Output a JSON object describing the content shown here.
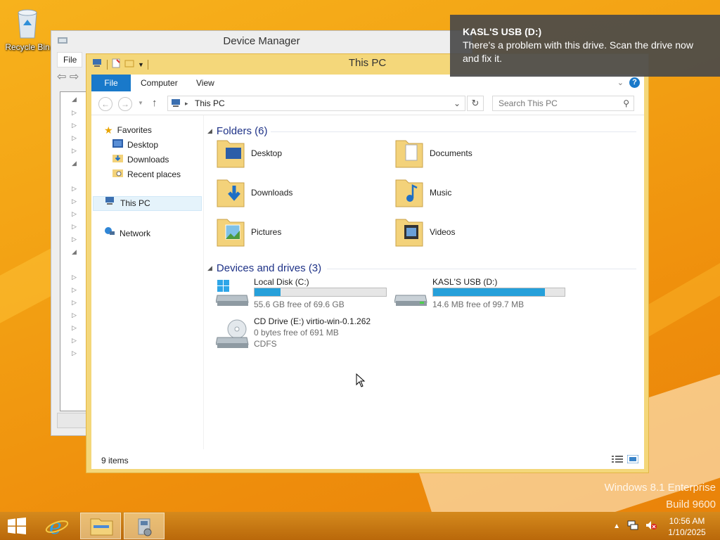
{
  "desktop": {
    "recycle_bin_label": "Recycle Bin",
    "watermark_line1": "Windows 8.1 Enterprise",
    "watermark_line2": "Build 9600"
  },
  "device_manager": {
    "title": "Device Manager",
    "menu_file": "File"
  },
  "explorer": {
    "title": "This PC",
    "ribbon_tabs": {
      "file": "File",
      "computer": "Computer",
      "view": "View"
    },
    "help_glyph": "?",
    "address": "This PC",
    "search_placeholder": "Search This PC",
    "nav": {
      "favorites": "Favorites",
      "desktop": "Desktop",
      "downloads": "Downloads",
      "recent": "Recent places",
      "this_pc": "This PC",
      "network": "Network"
    },
    "folders_header": "Folders (6)",
    "folders": [
      {
        "label": "Desktop"
      },
      {
        "label": "Documents"
      },
      {
        "label": "Downloads"
      },
      {
        "label": "Music"
      },
      {
        "label": "Pictures"
      },
      {
        "label": "Videos"
      }
    ],
    "drives_header": "Devices and drives (3)",
    "drives": [
      {
        "name": "Local Disk (C:)",
        "free": "55.6 GB free of 69.6 GB",
        "used_fraction": 0.2
      },
      {
        "name": "KASL'S USB (D:)",
        "free": "14.6 MB free of 99.7 MB",
        "used_fraction": 0.85
      },
      {
        "name": "CD Drive (E:) virtio-win-0.1.262",
        "free": "0 bytes free of 691 MB",
        "fs": "CDFS"
      }
    ],
    "status_items": "9 items"
  },
  "toast": {
    "title": "KASL'S USB (D:)",
    "body": "There's a problem with this drive. Scan the drive now and fix it."
  },
  "taskbar": {
    "time": "10:56 AM",
    "date": "1/10/2025"
  }
}
